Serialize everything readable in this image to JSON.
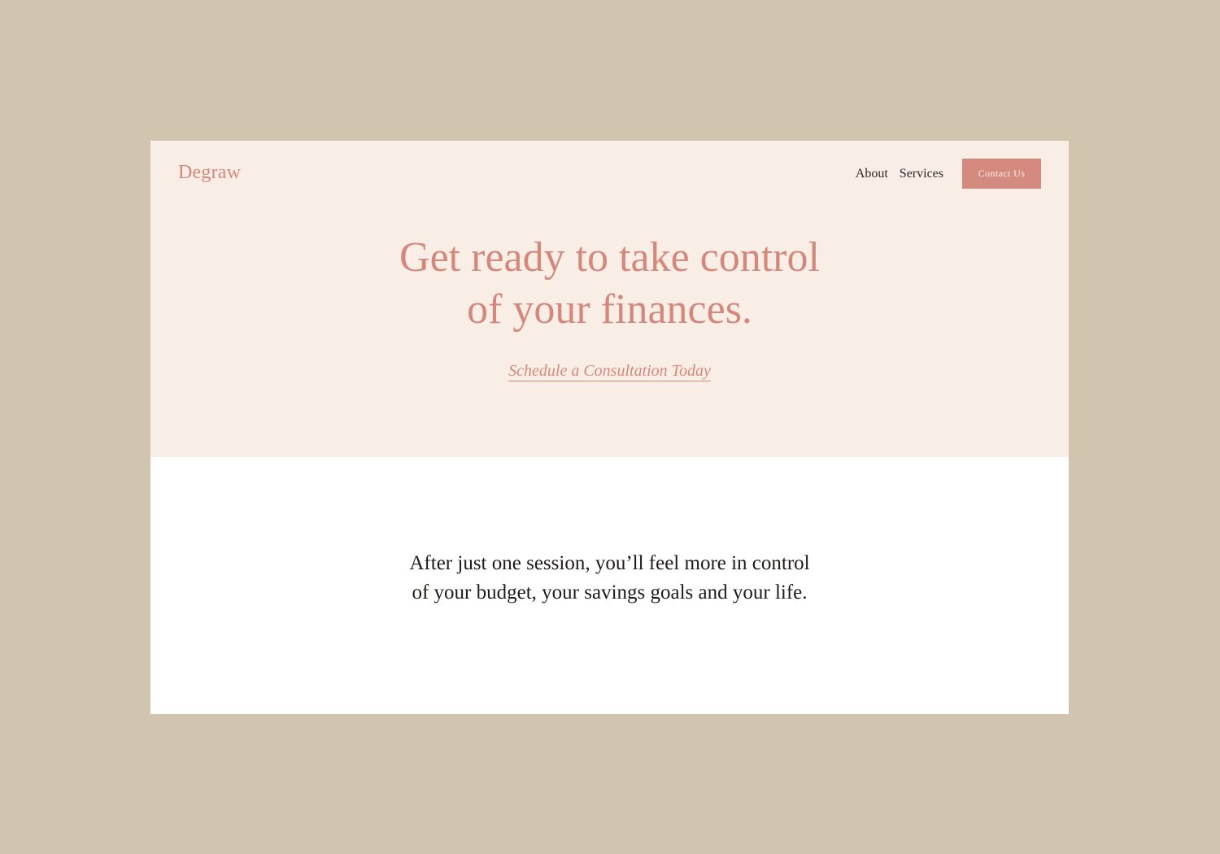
{
  "header": {
    "logo": "Degraw",
    "nav": {
      "about": "About",
      "services": "Services",
      "contact_button": "Contact Us"
    }
  },
  "hero": {
    "headline_line1": "Get ready to take control",
    "headline_line2": "of your finances.",
    "cta_link": "Schedule a Consultation Today"
  },
  "intro": {
    "line1": "After just one session, you’ll feel more in control",
    "line2": "of your budget, your savings goals and your life."
  },
  "colors": {
    "outer_background": "#d2c5af",
    "hero_background": "#f9eee6",
    "accent": "#d4887c",
    "button": "#d58a7f",
    "body_text": "#1e1b1a"
  }
}
